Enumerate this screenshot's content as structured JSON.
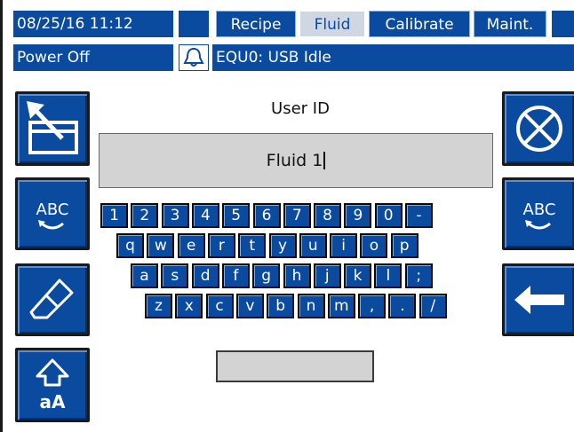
{
  "header": {
    "datetime": "08/25/16 11:12",
    "tabs": [
      {
        "label": "Recipe",
        "active": false
      },
      {
        "label": "Fluid",
        "active": true
      },
      {
        "label": "Calibrate",
        "active": false
      },
      {
        "label": "Maint.",
        "active": false
      }
    ],
    "power_status": "Power Off",
    "alarm_icon": "bell-icon",
    "event_message": "EQU0: USB Idle"
  },
  "entry": {
    "label": "User ID",
    "value": "Fluid 1"
  },
  "left_buttons": [
    {
      "name": "exit-screen-button",
      "icon": "exit-arrow-icon"
    },
    {
      "name": "abc-mode-button-left",
      "label": "ABC",
      "icon": "abc-toggle-icon"
    },
    {
      "name": "erase-button",
      "icon": "eraser-icon"
    },
    {
      "name": "shift-button",
      "label": "aA",
      "icon": "shift-arrow-icon"
    }
  ],
  "right_buttons": [
    {
      "name": "cancel-button",
      "icon": "cancel-x-icon"
    },
    {
      "name": "abc-mode-button-right",
      "label": "ABC",
      "icon": "abc-toggle-icon"
    },
    {
      "name": "backspace-button",
      "icon": "left-arrow-icon"
    }
  ],
  "keyboard": {
    "rows": [
      [
        "1",
        "2",
        "3",
        "4",
        "5",
        "6",
        "7",
        "8",
        "9",
        "0",
        "-"
      ],
      [
        "q",
        "w",
        "e",
        "r",
        "t",
        "y",
        "u",
        "i",
        "o",
        "p"
      ],
      [
        "a",
        "s",
        "d",
        "f",
        "g",
        "h",
        "j",
        "k",
        "l",
        ";"
      ],
      [
        "z",
        "x",
        "c",
        "v",
        "b",
        "n",
        "m",
        ",",
        ".",
        "/"
      ]
    ]
  },
  "colors": {
    "primary_blue": "#0a4a9f",
    "active_tab": "#cfd8e2",
    "entry_bg": "#d3d3d3"
  }
}
